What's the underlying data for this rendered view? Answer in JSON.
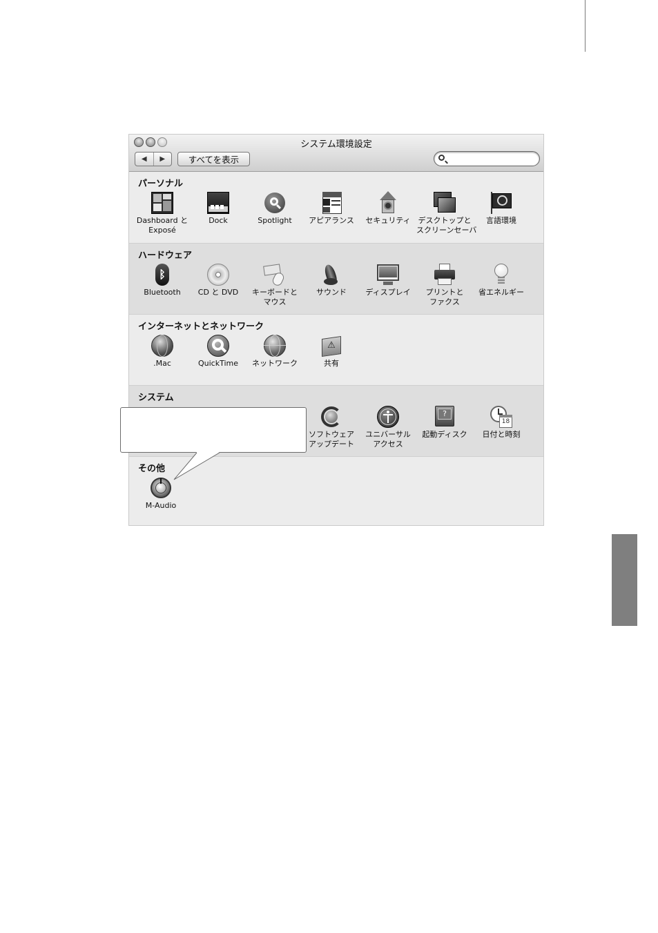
{
  "window": {
    "title": "システム環境設定",
    "nav": {
      "back": "◀",
      "forward": "▶"
    },
    "show_all_label": "すべてを表示",
    "search": {
      "value": "",
      "placeholder": ""
    }
  },
  "sections": [
    {
      "title": "パーソナル",
      "items": [
        {
          "line1": "Dashboard と",
          "line2": "Exposé",
          "icon": "dashboard-expose-icon"
        },
        {
          "line1": "Dock",
          "line2": "",
          "icon": "dock-icon"
        },
        {
          "line1": "Spotlight",
          "line2": "",
          "icon": "spotlight-icon"
        },
        {
          "line1": "アピアランス",
          "line2": "",
          "icon": "appearance-icon"
        },
        {
          "line1": "セキュリティ",
          "line2": "",
          "icon": "security-house-icon"
        },
        {
          "line1": "デスクトップと",
          "line2": "スクリーンセーバ",
          "icon": "desktop-screensaver-icon"
        },
        {
          "line1": "言語環境",
          "line2": "",
          "icon": "language-flag-icon"
        }
      ]
    },
    {
      "title": "ハードウェア",
      "items": [
        {
          "line1": "Bluetooth",
          "line2": "",
          "icon": "bluetooth-icon"
        },
        {
          "line1": "CD と DVD",
          "line2": "",
          "icon": "cd-dvd-icon"
        },
        {
          "line1": "キーボードと",
          "line2": "マウス",
          "icon": "keyboard-mouse-icon"
        },
        {
          "line1": "サウンド",
          "line2": "",
          "icon": "speaker-icon"
        },
        {
          "line1": "ディスプレイ",
          "line2": "",
          "icon": "display-icon"
        },
        {
          "line1": "プリントと",
          "line2": "ファクス",
          "icon": "printer-icon"
        },
        {
          "line1": "省エネルギー",
          "line2": "",
          "icon": "lightbulb-icon"
        }
      ]
    },
    {
      "title": "インターネットとネットワーク",
      "items": [
        {
          "line1": ".Mac",
          "line2": "",
          "icon": "dotmac-globe-icon"
        },
        {
          "line1": "QuickTime",
          "line2": "",
          "icon": "quicktime-icon"
        },
        {
          "line1": "ネットワーク",
          "line2": "",
          "icon": "network-globe-icon"
        },
        {
          "line1": "共有",
          "line2": "",
          "icon": "sharing-folder-icon"
        }
      ]
    },
    {
      "title": "システム",
      "items": [
        {
          "line1": "ソフトウェア",
          "line2": "アップデート",
          "icon": "software-update-icon"
        },
        {
          "line1": "ユニバーサル",
          "line2": "アクセス",
          "icon": "universal-access-icon"
        },
        {
          "line1": "起動ディスク",
          "line2": "",
          "icon": "startup-disk-icon"
        },
        {
          "line1": "日付と時刻",
          "line2": "",
          "icon": "date-time-clock-icon"
        }
      ]
    },
    {
      "title": "その他",
      "items": [
        {
          "line1": "M-Audio",
          "line2": "",
          "icon": "m-audio-knob-icon"
        }
      ]
    }
  ],
  "calendar_day": "18"
}
